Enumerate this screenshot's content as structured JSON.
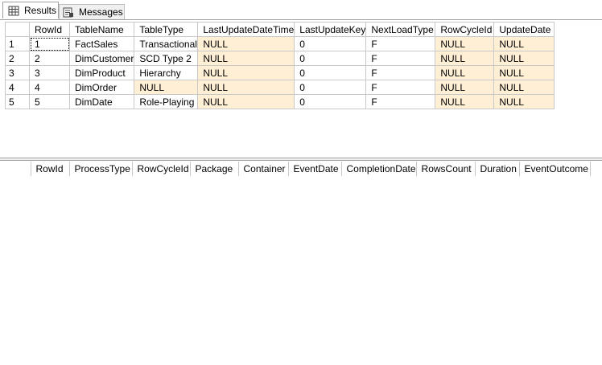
{
  "tabs": {
    "results_label": "Results",
    "messages_label": "Messages"
  },
  "grid1": {
    "columns": [
      "RowId",
      "TableName",
      "TableType",
      "LastUpdateDateTime",
      "LastUpdateKey",
      "NextLoadType",
      "RowCycleId",
      "UpdateDate"
    ],
    "rows": [
      {
        "num": "1",
        "cells": [
          "1",
          "FactSales",
          "Transactional",
          "NULL",
          "0",
          "F",
          "NULL",
          "NULL"
        ]
      },
      {
        "num": "2",
        "cells": [
          "2",
          "DimCustomer",
          "SCD Type 2",
          "NULL",
          "0",
          "F",
          "NULL",
          "NULL"
        ]
      },
      {
        "num": "3",
        "cells": [
          "3",
          "DimProduct",
          "Hierarchy",
          "NULL",
          "0",
          "F",
          "NULL",
          "NULL"
        ]
      },
      {
        "num": "4",
        "cells": [
          "4",
          "DimOrder",
          "NULL",
          "NULL",
          "0",
          "F",
          "NULL",
          "NULL"
        ]
      },
      {
        "num": "5",
        "cells": [
          "5",
          "DimDate",
          "Role-Playing",
          "NULL",
          "0",
          "F",
          "NULL",
          "NULL"
        ]
      }
    ]
  },
  "grid2": {
    "columns": [
      "RowId",
      "ProcessType",
      "RowCycleId",
      "Package",
      "Container",
      "EventDate",
      "CompletionDate",
      "RowsCount",
      "Duration",
      "EventOutcome"
    ]
  },
  "colors": {
    "null_cell": "#ffefd5",
    "grid_line": "#c8c8c8"
  }
}
